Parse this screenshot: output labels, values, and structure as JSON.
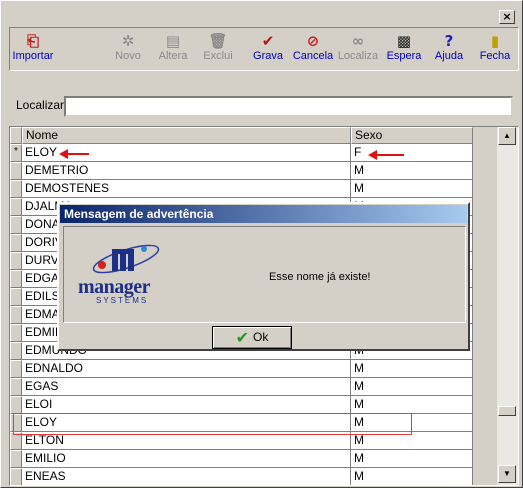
{
  "titlebar": {
    "close_label": "×"
  },
  "toolbar": {
    "buttons": [
      {
        "label": "Importar",
        "icon": "import-icon",
        "glyph": "⎗",
        "enabled": true
      },
      {
        "label": "Novo",
        "icon": "new-icon",
        "glyph": "✲",
        "enabled": false
      },
      {
        "label": "Altera",
        "icon": "edit-icon",
        "glyph": "▤",
        "enabled": false
      },
      {
        "label": "Exclui",
        "icon": "trash-icon",
        "glyph": "🗑",
        "enabled": false
      },
      {
        "label": "Grava",
        "icon": "checkmark-icon",
        "glyph": "✔",
        "enabled": true
      },
      {
        "label": "Cancela",
        "icon": "cancel-icon",
        "glyph": "⊘",
        "enabled": true
      },
      {
        "label": "Localiza",
        "icon": "binoculars-icon",
        "glyph": "∞",
        "enabled": false
      },
      {
        "label": "Espera",
        "icon": "wait-icon",
        "glyph": "▩",
        "enabled": true
      },
      {
        "label": "Ajuda",
        "icon": "help-icon",
        "glyph": "?",
        "enabled": true
      },
      {
        "label": "Fecha",
        "icon": "exit-door-icon",
        "glyph": "▮",
        "enabled": true
      }
    ]
  },
  "search": {
    "label": "Localizar",
    "value": ""
  },
  "grid": {
    "columns": [
      "Nome",
      "Sexo"
    ],
    "rows": [
      {
        "indicator": "*",
        "nome": "ELOY",
        "sexo": "F"
      },
      {
        "indicator": "",
        "nome": "DEMETRIO",
        "sexo": "M"
      },
      {
        "indicator": "",
        "nome": "DEMOSTENES",
        "sexo": "M"
      },
      {
        "indicator": "",
        "nome": "DJALMA",
        "sexo": "M"
      },
      {
        "indicator": "",
        "nome": "DONATO",
        "sexo": "M"
      },
      {
        "indicator": "",
        "nome": "DORIVAL",
        "sexo": "M"
      },
      {
        "indicator": "",
        "nome": "DURVAL",
        "sexo": "M"
      },
      {
        "indicator": "",
        "nome": "EDGAR",
        "sexo": "M"
      },
      {
        "indicator": "",
        "nome": "EDILSON",
        "sexo": "M"
      },
      {
        "indicator": "",
        "nome": "EDMAR",
        "sexo": "M"
      },
      {
        "indicator": "",
        "nome": "EDMILSON",
        "sexo": "M"
      },
      {
        "indicator": "",
        "nome": "EDMUNDO",
        "sexo": "M"
      },
      {
        "indicator": "",
        "nome": "EDNALDO",
        "sexo": "M"
      },
      {
        "indicator": "",
        "nome": "EGAS",
        "sexo": "M"
      },
      {
        "indicator": "",
        "nome": "ELOI",
        "sexo": "M"
      },
      {
        "indicator": "",
        "nome": "ELOY",
        "sexo": "M"
      },
      {
        "indicator": "",
        "nome": "ELTON",
        "sexo": "M"
      },
      {
        "indicator": "",
        "nome": "EMILIO",
        "sexo": "M"
      },
      {
        "indicator": "",
        "nome": "ENEAS",
        "sexo": "M"
      }
    ]
  },
  "dialog": {
    "title": "Mensagem de advertência",
    "message": "Esse nome já existe!",
    "ok_label": "Ok",
    "logo_text": "manager",
    "logo_subtext": "SYSTEMS"
  },
  "colors": {
    "annotation_red": "#e01010",
    "link_blue": "#0000c0",
    "dialog_title_start": "#0a246a"
  }
}
